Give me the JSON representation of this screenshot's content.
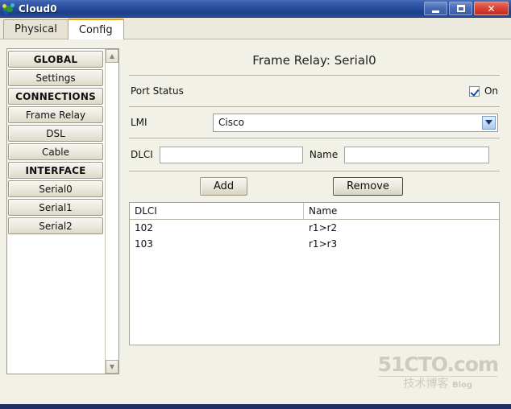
{
  "window": {
    "title": "Cloud0",
    "icon": "cloud-network-icon",
    "controls": {
      "minimize": "minimize-icon",
      "maximize": "maximize-icon",
      "close": "close-icon",
      "close_glyph": "✕"
    }
  },
  "tabs": [
    {
      "label": "Physical",
      "active": false
    },
    {
      "label": "Config",
      "active": true
    }
  ],
  "sidebar": {
    "items": [
      {
        "label": "GLOBAL",
        "header": true
      },
      {
        "label": "Settings",
        "header": false
      },
      {
        "label": "CONNECTIONS",
        "header": true
      },
      {
        "label": "Frame Relay",
        "header": false
      },
      {
        "label": "DSL",
        "header": false
      },
      {
        "label": "Cable",
        "header": false
      },
      {
        "label": "INTERFACE",
        "header": true
      },
      {
        "label": "Serial0",
        "header": false
      },
      {
        "label": "Serial1",
        "header": false
      },
      {
        "label": "Serial2",
        "header": false
      }
    ],
    "scroll_up": "▲",
    "scroll_down": "▼"
  },
  "panel": {
    "title": "Frame Relay: Serial0",
    "port_status": {
      "label": "Port Status",
      "checked": true,
      "checkbox_label": "On"
    },
    "lmi": {
      "label": "LMI",
      "value": "Cisco"
    },
    "entry": {
      "dlci_label": "DLCI",
      "dlci_value": "",
      "dlci_placeholder": "",
      "name_label": "Name",
      "name_value": "",
      "name_placeholder": ""
    },
    "buttons": {
      "add": "Add",
      "remove": "Remove"
    },
    "table": {
      "columns": [
        "DLCI",
        "Name"
      ],
      "rows": [
        [
          "102",
          "r1>r2"
        ],
        [
          "103",
          "r1>r3"
        ]
      ]
    }
  },
  "watermark": {
    "line1": "51CTO.com",
    "line2": "技术博客",
    "line3": "Blog"
  },
  "colors": {
    "titlebar": "#2e50a2",
    "accent_tab": "#e8a317",
    "checkmark": "#15499b",
    "panel_bg": "#f2f1e8",
    "bottom_bar": "#1b2f66"
  }
}
